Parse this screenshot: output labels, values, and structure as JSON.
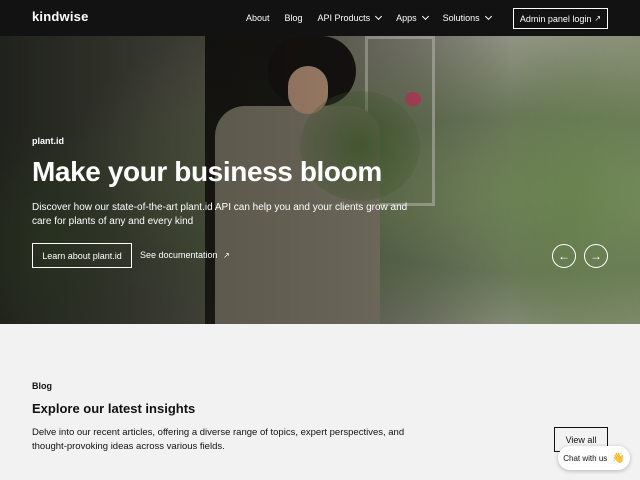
{
  "header": {
    "logo": "kindwise",
    "nav": [
      {
        "label": "About"
      },
      {
        "label": "Blog"
      },
      {
        "label": "API Products"
      },
      {
        "label": "Apps"
      },
      {
        "label": "Solutions"
      }
    ],
    "admin_button": "Admin panel login",
    "admin_icon": "↗"
  },
  "hero": {
    "eyebrow": "plant.id",
    "title": "Make your business bloom",
    "description": "Discover how our state-of-the-art plant.id API can help you and your clients grow and care for plants of any and every kind",
    "primary_button": "Learn about plant.id",
    "secondary_link": "See documentation",
    "secondary_icon": "↗",
    "prev_icon": "←",
    "next_icon": "→"
  },
  "blog": {
    "eyebrow": "Blog",
    "title": "Explore our latest insights",
    "description": "Delve into our recent articles, offering a diverse range of topics, expert perspectives, and thought-provoking ideas across various fields.",
    "view_all": "View all"
  },
  "chat": {
    "label": "Chat with us",
    "icon": "👋"
  },
  "colors": {
    "header_bg": "#121212",
    "section_bg": "#f2f2f2",
    "text_dark": "#111111",
    "text_light": "#ffffff"
  }
}
